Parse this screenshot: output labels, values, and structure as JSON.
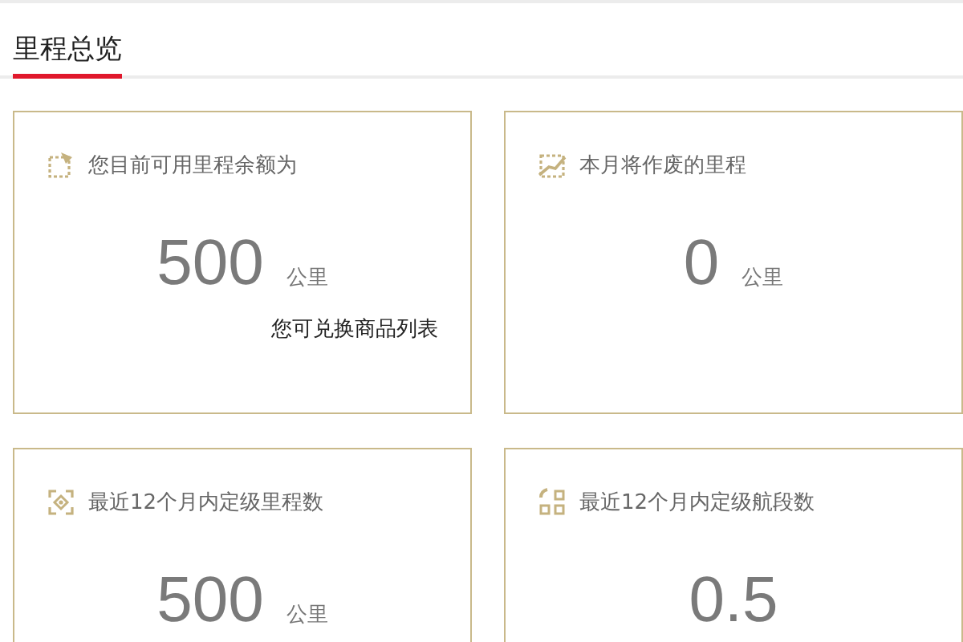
{
  "section": {
    "title": "里程总览"
  },
  "cards": [
    {
      "title": "您目前可用里程余额为",
      "value": "500",
      "unit": "公里",
      "link": "您可兑换商品列表"
    },
    {
      "title": "本月将作废的里程",
      "value": "0",
      "unit": "公里"
    },
    {
      "title": "最近12个月内定级里程数",
      "value": "500",
      "unit": "公里"
    },
    {
      "title": "最近12个月内定级航段数",
      "value": "0.5"
    }
  ]
}
